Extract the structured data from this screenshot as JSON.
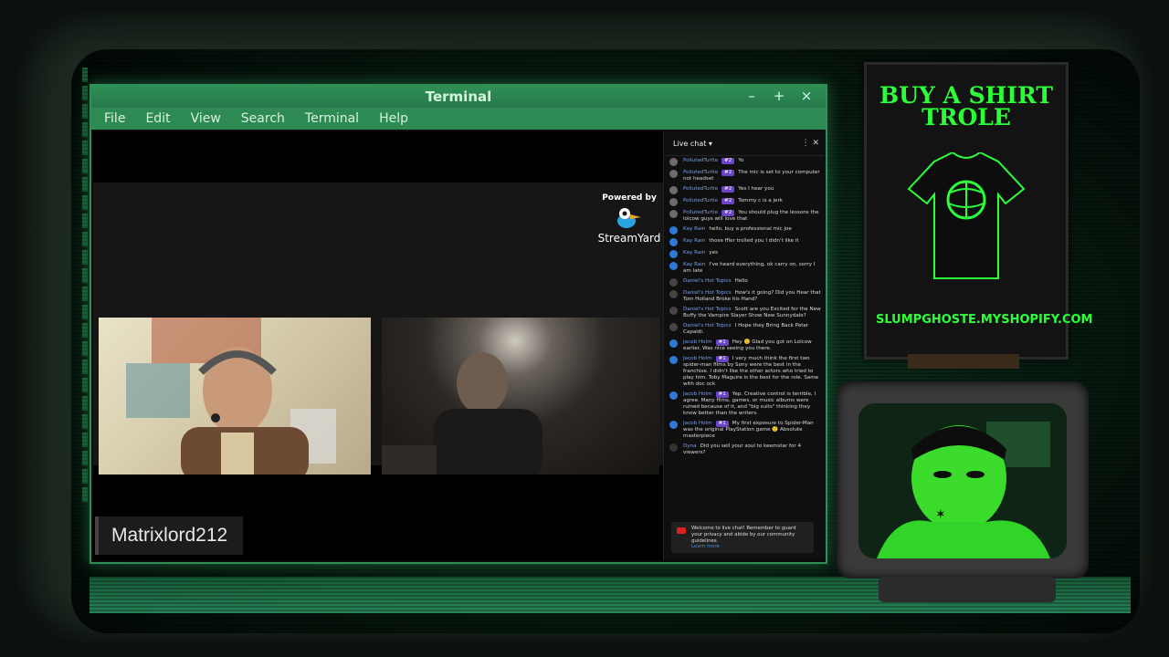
{
  "terminal": {
    "title": "Terminal",
    "menu": [
      "File",
      "Edit",
      "View",
      "Search",
      "Terminal",
      "Help"
    ],
    "controls": {
      "minimize": "–",
      "maximize": "+",
      "close": "×"
    }
  },
  "stream": {
    "powered_by": "Powered by",
    "brand": "StreamYard",
    "guest_name": "Matrixlord212"
  },
  "chat": {
    "header": "Live chat",
    "messages": [
      {
        "author": "PollutedTurtle",
        "badge": "#2",
        "text": "Yo",
        "color": "#6b6b6b"
      },
      {
        "author": "PollutedTurtle",
        "badge": "#2",
        "text": "The mic is set to your computer not headset",
        "color": "#6b6b6b"
      },
      {
        "author": "PollutedTurtle",
        "badge": "#2",
        "text": "Yes I hear you",
        "color": "#6b6b6b"
      },
      {
        "author": "PollutedTurtle",
        "badge": "#2",
        "text": "Tommy c is a jerk",
        "color": "#6b6b6b"
      },
      {
        "author": "PollutedTurtle",
        "badge": "#2",
        "text": "You should plug the lessons the lolcow guys will love that",
        "color": "#6b6b6b"
      },
      {
        "author": "Kay Rain",
        "badge": "",
        "text": "hello, buy a professional mic joe",
        "color": "#2d7ad6"
      },
      {
        "author": "Kay Rain",
        "badge": "",
        "text": "those ffler trolled you I didn't like it",
        "color": "#2d7ad6"
      },
      {
        "author": "Kay Rain",
        "badge": "",
        "text": "yes",
        "color": "#2d7ad6"
      },
      {
        "author": "Kay Rain",
        "badge": "",
        "text": "I've heard everything, ok carry on, sorry I am late",
        "color": "#2d7ad6"
      },
      {
        "author": "Daniel's Hot Topics",
        "badge": "",
        "text": "Hello",
        "color": "#444444"
      },
      {
        "author": "Daniel's Hot Topics",
        "badge": "",
        "text": "How's it going? Did you Hear that Tom Holland Broke his Hand?",
        "color": "#444444"
      },
      {
        "author": "Daniel's Hot Topics",
        "badge": "",
        "text": "Scott are you Excited for the New Buffy the Vampire Slayer Show New Sunnydale?",
        "color": "#444444"
      },
      {
        "author": "Daniel's Hot Topics",
        "badge": "",
        "text": "I Hope they Bring Back Peter Capaldi.",
        "color": "#444444"
      },
      {
        "author": "Jacob Holm",
        "badge": "#1",
        "text": "Hey 🙂 Glad you got on Lolcow earlier. Was nice seeing you there.",
        "color": "#2d7ad6"
      },
      {
        "author": "Jacob Holm",
        "badge": "#1",
        "text": "I very much think the first two spider-man films by Sony were the best in the franchise. I didn't like the other actors who tried to play him. Toby Maguire is the best for the role. Same with doc ock",
        "color": "#2d7ad6"
      },
      {
        "author": "Jacob Holm",
        "badge": "#1",
        "text": "Yep. Creative control is terrible, I agree. Many films, games, or music albums were ruined because of it, and \"big suits\" thinking they know better than the writers.",
        "color": "#2d7ad6"
      },
      {
        "author": "Jacob Holm",
        "badge": "#1",
        "text": "My first exposure to Spider-Man was the original PlayStation game 🙂 Absolute masterpiece",
        "color": "#2d7ad6"
      },
      {
        "author": "Dyna",
        "badge": "",
        "text": "Did you sell your soul to keemstar for 4 viewers?",
        "color": "#333333"
      }
    ],
    "footer_notice": "Welcome to live chat! Remember to guard your privacy and abide by our community guidelines.",
    "footer_link": "Learn more"
  },
  "poster": {
    "headline_line1": "BUY A SHIRT",
    "headline_line2": "TROLE",
    "url": "SLUMPGHOSTE.MYSHOPIFY.COM"
  },
  "accent_color": "#2cff3a"
}
